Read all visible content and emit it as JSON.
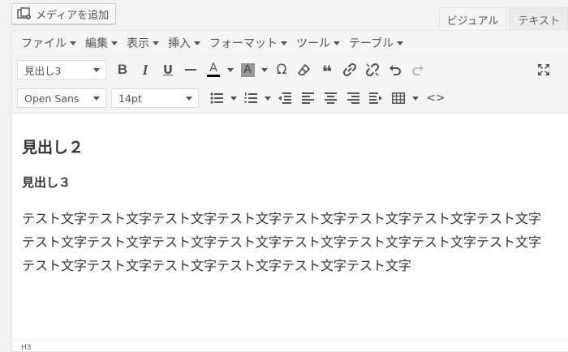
{
  "header": {
    "add_media_label": "メディアを追加",
    "tabs": {
      "visual": "ビジュアル",
      "text": "テキスト"
    }
  },
  "menubar": {
    "file": "ファイル",
    "edit": "編集",
    "view": "表示",
    "insert": "挿入",
    "format": "フォーマット",
    "tools": "ツール",
    "table": "テーブル"
  },
  "toolbar": {
    "format_select": "見出し3",
    "font_family_select": "Open Sans",
    "font_size_select": "14pt",
    "icons": [
      "bold",
      "italic",
      "underline",
      "horizontal-line",
      "text-color",
      "background-color",
      "special-character",
      "clear-formatting",
      "blockquote",
      "insert-link",
      "remove-link",
      "undo",
      "redo",
      "fullscreen",
      "bullet-list",
      "numbered-list",
      "outdent",
      "align-left",
      "align-center",
      "align-right",
      "indent",
      "table",
      "source-code"
    ],
    "bold_glyph": "B",
    "italic_glyph": "I",
    "underline_glyph": "U",
    "text_color_glyph": "A",
    "bg_color_glyph": "A",
    "omega_glyph": "Ω",
    "quote_glyph": "❝",
    "code_glyph": "<>"
  },
  "content": {
    "heading2": "見出し２",
    "heading3": "見出し３",
    "paragraph": "テスト文字テスト文字テスト文字テスト文字テスト文字テスト文字テスト文字テスト文字テスト文字テスト文字テスト文字テスト文字テスト文字テスト文字テスト文字テスト文字テスト文字テスト文字テスト文字テスト文字テスト文字テスト文字"
  },
  "statusbar": {
    "path": "H3"
  },
  "colors": {
    "text_color_bar": "#000000",
    "bg_color_swatch": "#999999"
  }
}
